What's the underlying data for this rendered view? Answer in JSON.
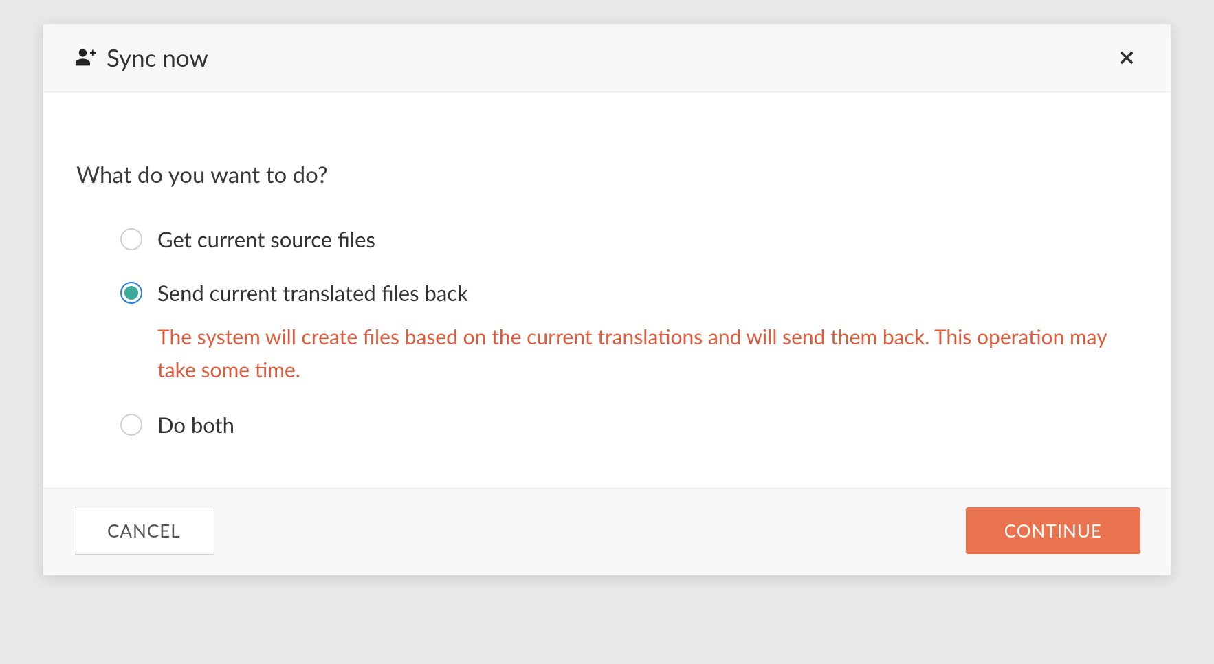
{
  "header": {
    "title": "Sync now"
  },
  "body": {
    "prompt": "What do you want to do?",
    "options": [
      {
        "label": "Get current source files",
        "selected": false,
        "description": ""
      },
      {
        "label": "Send current translated files back",
        "selected": true,
        "description": "The system will create files based on the current translations and will send them back. This operation may take some time."
      },
      {
        "label": "Do both",
        "selected": false,
        "description": ""
      }
    ]
  },
  "footer": {
    "cancel_label": "CANCEL",
    "continue_label": "CONTINUE"
  }
}
